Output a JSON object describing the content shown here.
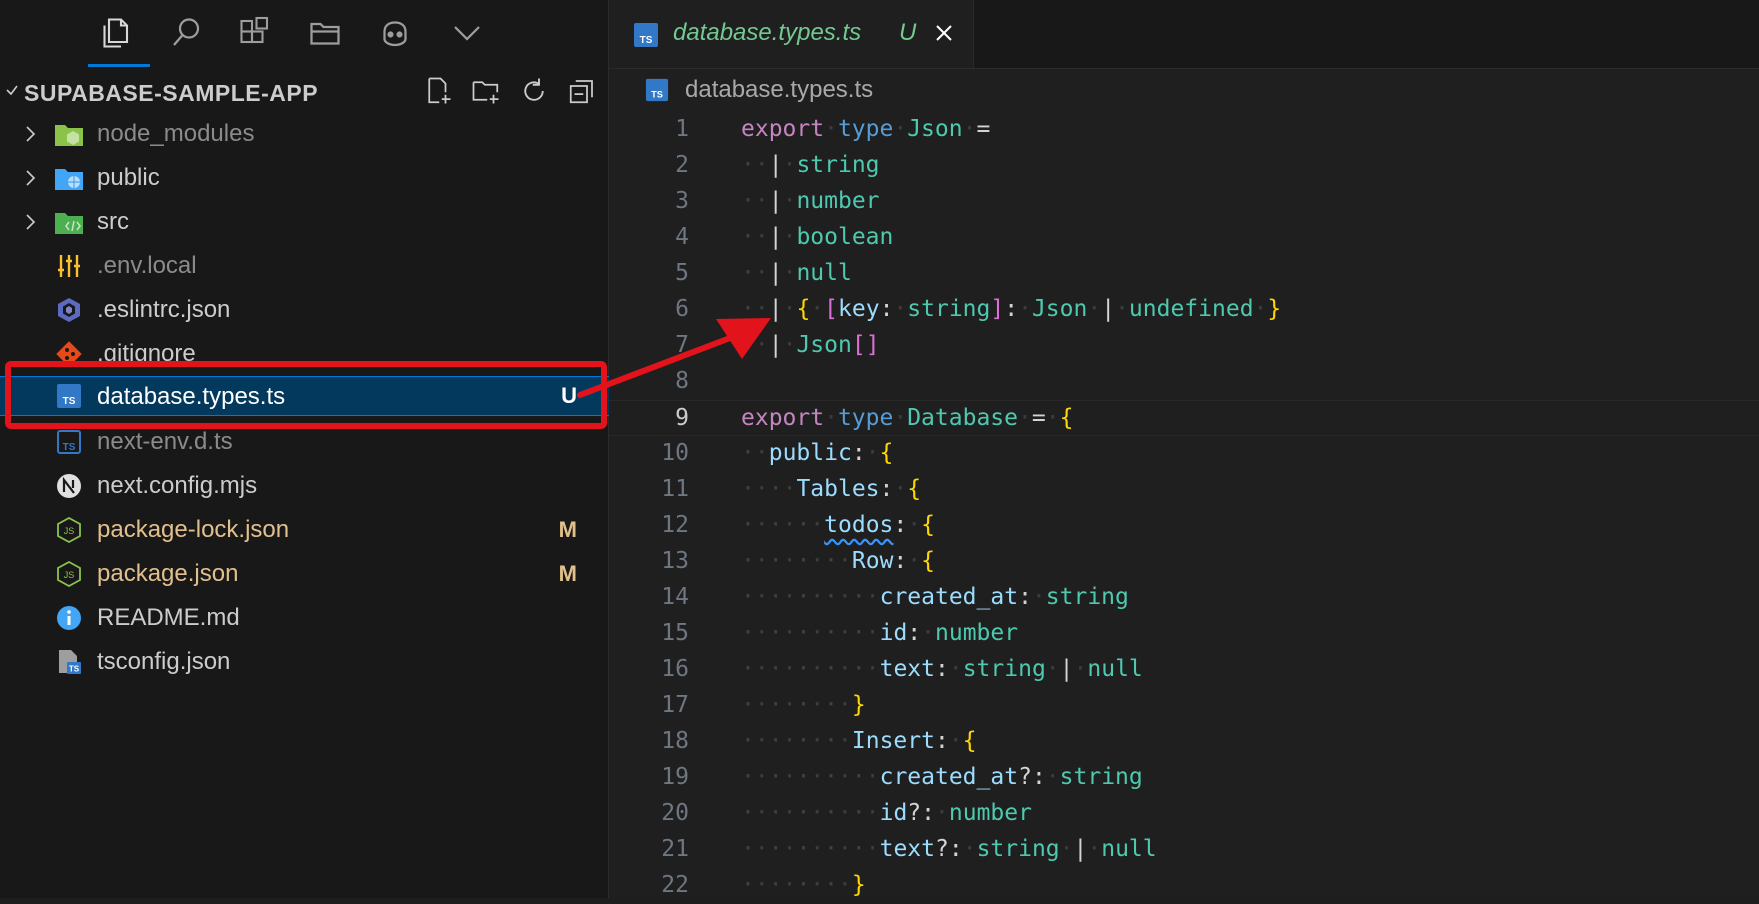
{
  "colors": {
    "accent": "#0078d4",
    "selection": "#04395e",
    "untracked": "#73c991",
    "modified": "#e2c08d",
    "annotation": "#e3131b"
  },
  "activity_bar": {
    "icons": [
      "explorer-icon",
      "search-icon",
      "extensions-icon",
      "folder-view-icon",
      "copilot-icon",
      "chevron-down-icon"
    ]
  },
  "explorer": {
    "title": "SUPABASE-SAMPLE-APP",
    "actions": [
      "new-file-icon",
      "new-folder-icon",
      "refresh-icon",
      "collapse-all-icon"
    ],
    "items": [
      {
        "name": "node_modules",
        "kind": "folder",
        "icon": "node-folder-icon",
        "dim": true,
        "badge": ""
      },
      {
        "name": "public",
        "kind": "folder",
        "icon": "public-folder-icon",
        "dim": false,
        "badge": ""
      },
      {
        "name": "src",
        "kind": "folder",
        "icon": "src-folder-icon",
        "dim": false,
        "badge": ""
      },
      {
        "name": ".env.local",
        "kind": "file",
        "icon": "env-settings-icon",
        "dim": true,
        "badge": ""
      },
      {
        "name": ".eslintrc.json",
        "kind": "file",
        "icon": "eslint-icon",
        "dim": false,
        "badge": ""
      },
      {
        "name": ".gitignore",
        "kind": "file",
        "icon": "git-icon",
        "dim": false,
        "badge": ""
      },
      {
        "name": "database.types.ts",
        "kind": "file",
        "icon": "typescript-icon",
        "dim": false,
        "badge": "U"
      },
      {
        "name": "next-env.d.ts",
        "kind": "file",
        "icon": "typescript-def-icon",
        "dim": true,
        "badge": ""
      },
      {
        "name": "next.config.mjs",
        "kind": "file",
        "icon": "nextjs-icon",
        "dim": false,
        "badge": ""
      },
      {
        "name": "package-lock.json",
        "kind": "file",
        "icon": "nodejs-icon",
        "dim": false,
        "badge": "M"
      },
      {
        "name": "package.json",
        "kind": "file",
        "icon": "nodejs-icon",
        "dim": false,
        "badge": "M"
      },
      {
        "name": "README.md",
        "kind": "file",
        "icon": "info-icon",
        "dim": false,
        "badge": ""
      },
      {
        "name": "tsconfig.json",
        "kind": "file",
        "icon": "tsconfig-icon",
        "dim": false,
        "badge": ""
      }
    ]
  },
  "editor": {
    "tab": {
      "label": "database.types.ts",
      "badge": "U"
    },
    "breadcrumb": "database.types.ts",
    "current_line": 9,
    "lines": [
      {
        "n": "1",
        "t": "export type Json ="
      },
      {
        "n": "2",
        "t": "  | string"
      },
      {
        "n": "3",
        "t": "  | number"
      },
      {
        "n": "4",
        "t": "  | boolean"
      },
      {
        "n": "5",
        "t": "  | null"
      },
      {
        "n": "6",
        "t": "  | { [key: string]: Json | undefined }"
      },
      {
        "n": "7",
        "t": "  | Json[]"
      },
      {
        "n": "8",
        "t": ""
      },
      {
        "n": "9",
        "t": "export type Database = {"
      },
      {
        "n": "10",
        "t": "  public: {"
      },
      {
        "n": "11",
        "t": "    Tables: {"
      },
      {
        "n": "12",
        "t": "      todos: {"
      },
      {
        "n": "13",
        "t": "        Row: {"
      },
      {
        "n": "14",
        "t": "          created_at: string"
      },
      {
        "n": "15",
        "t": "          id: number"
      },
      {
        "n": "16",
        "t": "          text: string | null"
      },
      {
        "n": "17",
        "t": "        }"
      },
      {
        "n": "18",
        "t": "        Insert: {"
      },
      {
        "n": "19",
        "t": "          created_at?: string"
      },
      {
        "n": "20",
        "t": "          id?: number"
      },
      {
        "n": "21",
        "t": "          text?: string | null"
      },
      {
        "n": "22",
        "t": "        }"
      }
    ]
  }
}
